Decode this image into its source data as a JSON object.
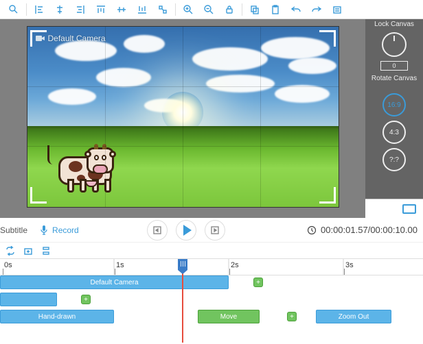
{
  "toolbar": {
    "lock_canvas_label": "Lock Canvas",
    "rotate_canvas_label": "Rotate Canvas",
    "rotation_value": "0"
  },
  "aspect": {
    "r169": "16:9",
    "r43": "4:3",
    "rcustom": "?:?"
  },
  "canvas": {
    "camera_label": "Default Camera"
  },
  "transport": {
    "subtitle_label": "Subtitle",
    "record_label": "Record",
    "timecode_current": "00:00:01.57",
    "timecode_total": "00:00:10.00"
  },
  "ruler": {
    "t0": "0s",
    "t1": "1s",
    "t2": "2s",
    "t3": "3s"
  },
  "clips": {
    "default_camera": "Default Camera",
    "hand_drawn": "Hand-drawn",
    "move": "Move",
    "zoom_out": "Zoom Out"
  }
}
